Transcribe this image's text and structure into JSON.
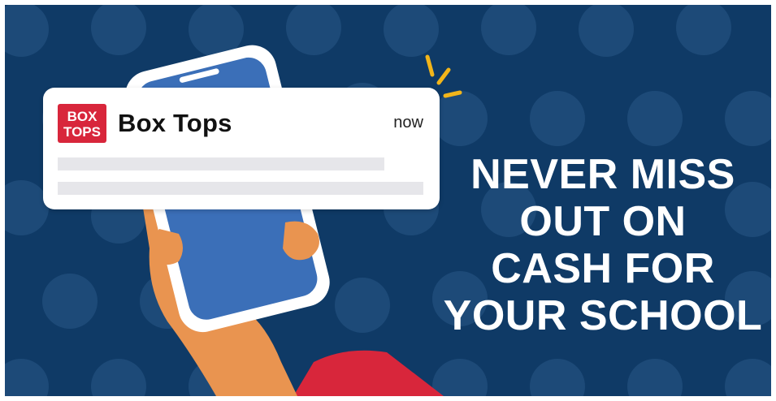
{
  "notification": {
    "logo_text": [
      "BOX",
      "TOPS"
    ],
    "app_name": "Box Tops",
    "timestamp": "now"
  },
  "headline": {
    "lines": [
      "NEVER MISS",
      "OUT ON",
      "CASH FOR",
      "YOUR SCHOOL"
    ]
  },
  "colors": {
    "background": "#0f3a66",
    "dots": "#1d4a78",
    "phone_body": "#ffffff",
    "phone_screen": "#3b6fb8",
    "hand": "#e99450",
    "sleeve": "#d8263b",
    "logo_red": "#d8263b",
    "sparkle": "#f2b51a"
  },
  "icons": [
    "box-tops-logo",
    "phone-illustration",
    "hand-illustration",
    "sparkle-icon"
  ]
}
